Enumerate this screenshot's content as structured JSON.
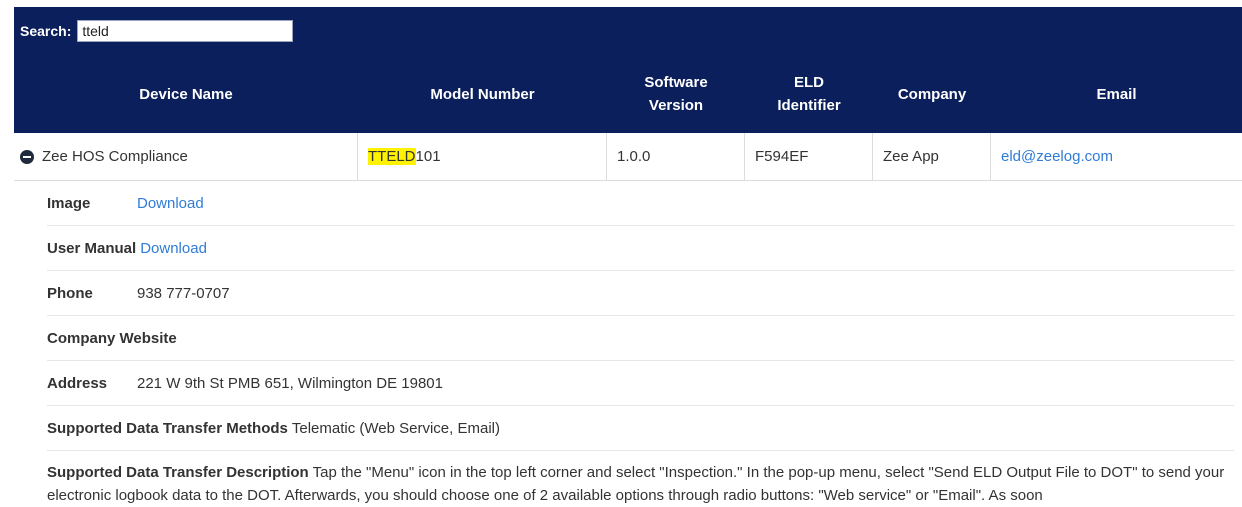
{
  "search": {
    "label": "Search:",
    "value": "tteld"
  },
  "columns": [
    "Device Name",
    "Model Number",
    "Software Version",
    "ELD Identifier",
    "Company",
    "Email"
  ],
  "row": {
    "device_name": "Zee HOS Compliance",
    "model_highlight": "TTELD",
    "model_rest": "101",
    "software_version": "1.0.0",
    "eld_identifier": "F594EF",
    "company": "Zee App",
    "email": "eld@zeelog.com"
  },
  "details": {
    "image_label": "Image",
    "image_link": "Download",
    "manual_label": "User Manual",
    "manual_link": "Download",
    "phone_label": "Phone",
    "phone_value": "938 777-0707",
    "website_label": "Company Website",
    "address_label": "Address",
    "address_value": "221 W 9th St PMB 651, Wilmington DE 19801",
    "methods_label": "Supported Data Transfer Methods",
    "methods_value": "Telematic (Web Service, Email)",
    "description_label": "Supported Data Transfer Description",
    "description_value": "Tap the \"Menu\" icon in the top left corner and select \"Inspection.\" In the pop-up menu, select \"Send ELD Output File to DOT\" to send your electronic logbook data to the DOT. Afterwards, you should choose one of 2 available options through radio buttons: \"Web service\" or \"Email\". As soon"
  },
  "colors": {
    "header_bg": "#0b1f5c",
    "link": "#2f7cd6",
    "highlight": "#fff200"
  }
}
